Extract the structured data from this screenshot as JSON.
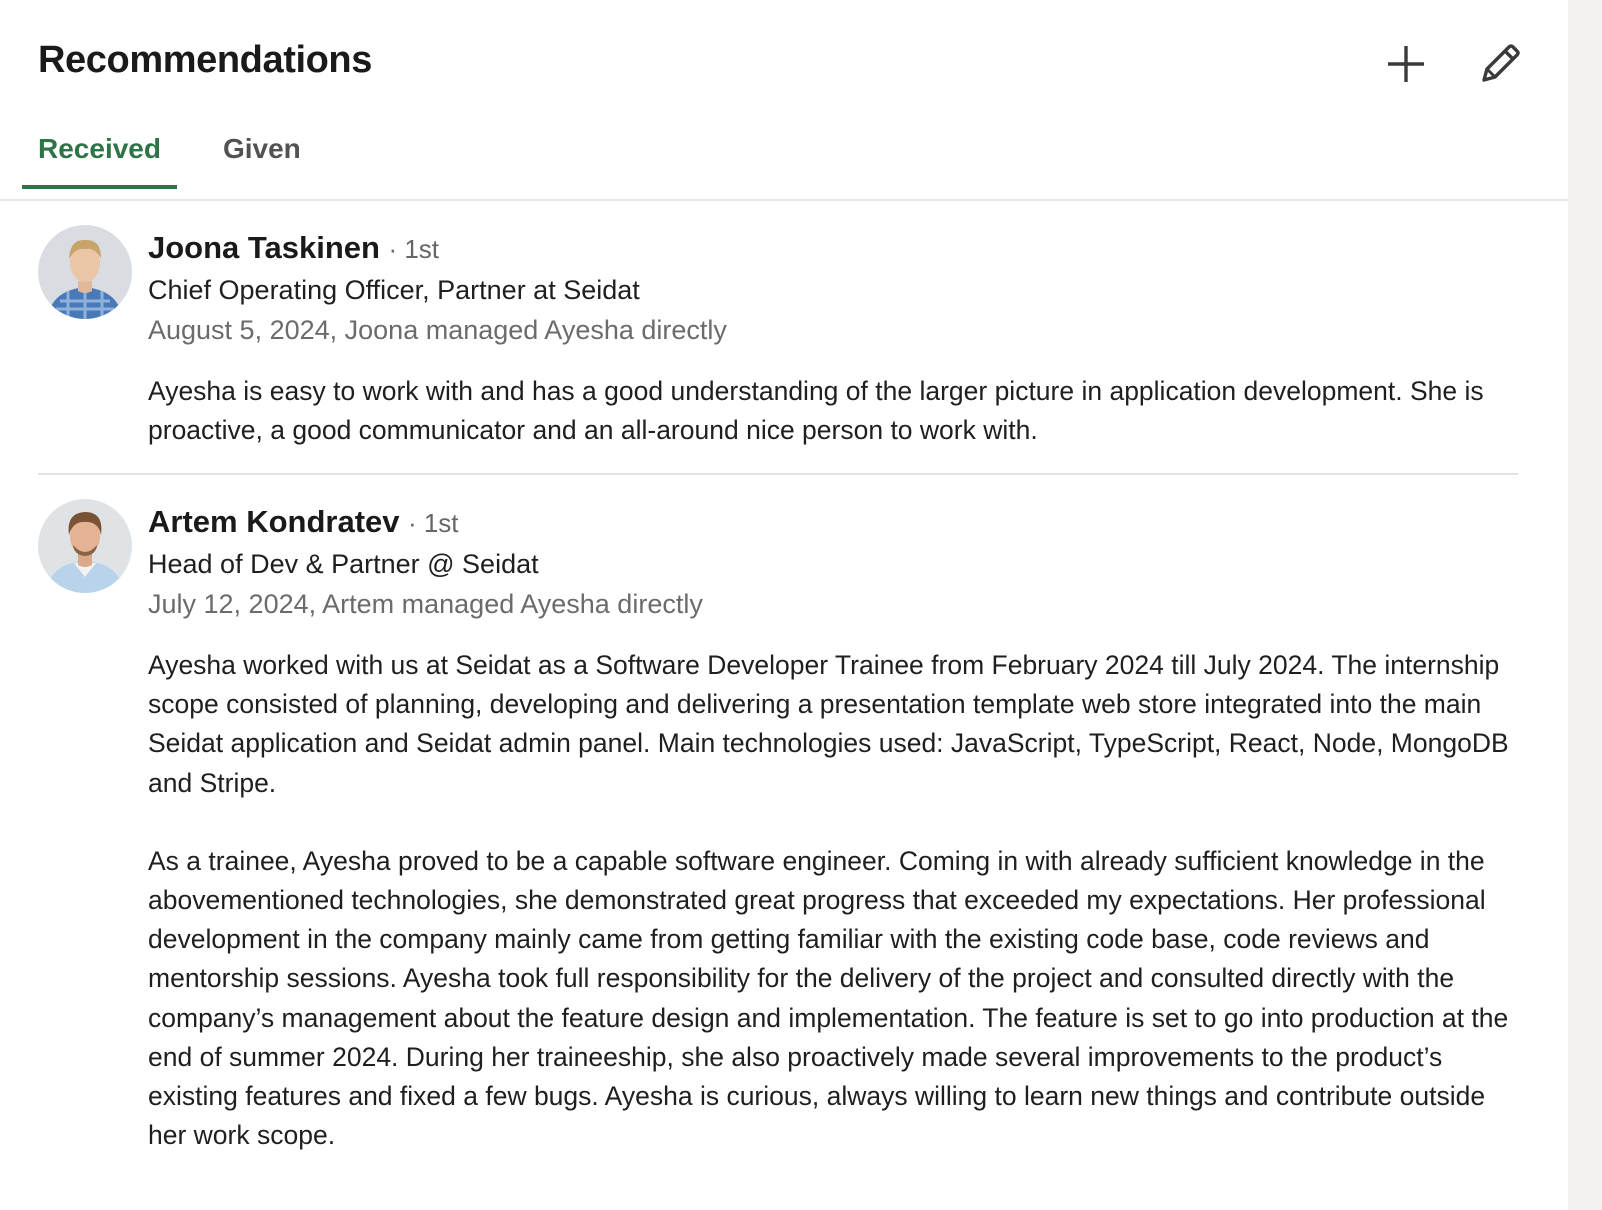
{
  "section": {
    "title": "Recommendations",
    "add_icon": "plus-icon",
    "edit_icon": "pencil-icon"
  },
  "tabs": [
    {
      "label": "Received",
      "active": true
    },
    {
      "label": "Given",
      "active": false
    }
  ],
  "colors": {
    "accent": "#2d7446",
    "text": "#1f1f1f",
    "muted": "#6b6b6b",
    "divider": "#e3e3e3",
    "page_background": "#f4f2ee"
  },
  "recommendations": [
    {
      "name": "Joona Taskinen",
      "degree": "· 1st",
      "headline": "Chief Operating Officer, Partner at Seidat",
      "meta": "August 5, 2024, Joona managed Ayesha directly",
      "avatar": "profile-photo-icon",
      "paragraphs": [
        "Ayesha is easy to work with and has a good understanding of the larger picture in application development. She is proactive, a good communicator and an all-around nice person to work with."
      ]
    },
    {
      "name": "Artem Kondratev",
      "degree": "· 1st",
      "headline": "Head of Dev & Partner @ Seidat",
      "meta": "July 12, 2024, Artem managed Ayesha directly",
      "avatar": "profile-photo-icon",
      "paragraphs": [
        "Ayesha worked with us at Seidat as a Software Developer Trainee from February 2024 till July 2024. The internship scope consisted of planning, developing and delivering a presentation template web store integrated into the main Seidat application and Seidat admin panel. Main technologies used: JavaScript, TypeScript, React, Node, MongoDB and Stripe.",
        "As a trainee, Ayesha proved to be a capable software engineer. Coming in with already sufficient knowledge in the abovementioned technologies, she demonstrated great progress that exceeded my expectations. Her professional development in the company mainly came from getting familiar with the existing code base, code reviews and mentorship sessions. Ayesha took full responsibility for the delivery of the project and consulted directly with the company’s management about the feature design and implementation. The feature is set to go into production at the end of summer 2024. During her traineeship, she also proactively made several improvements to the product’s existing features and fixed a few bugs. Ayesha is curious, always willing to learn new things and contribute outside her work scope."
      ]
    }
  ]
}
